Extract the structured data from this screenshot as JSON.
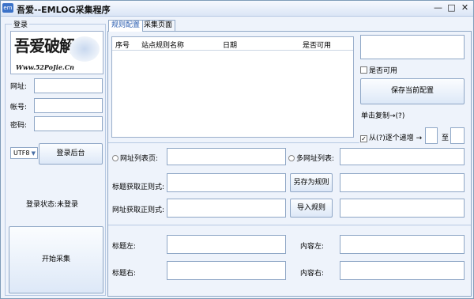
{
  "window": {
    "title": "吾爱--EMLOG采集程序",
    "icon_text": "em",
    "minimize": "—",
    "maximize": "□",
    "close": "✕"
  },
  "login": {
    "group_title": "登录",
    "logo_text": "吾爱破解",
    "logo_url": "Www.52PoJie.Cn",
    "url_label": "网址:",
    "url_value": "",
    "account_label": "帐号:",
    "account_value": "",
    "password_label": "密码:",
    "password_value": "",
    "encoding": "UTF8",
    "login_button": "登录后台",
    "status_label": "登录状态:",
    "status_value": "未登录",
    "start_button": "开始采集"
  },
  "tabs": [
    {
      "label": "规则配置"
    },
    {
      "label": "采集页面"
    }
  ],
  "rules_table": {
    "columns": [
      "序号",
      "站点规则名称",
      "日期",
      "是否可用"
    ],
    "rows": []
  },
  "right_panel": {
    "available_label": "是否可用",
    "save_button": "保存当前配置",
    "copy_hint": "单击复制→(?)",
    "increment_label": "从(?)逐个递增 →",
    "to_label": "至",
    "from_value": "",
    "to_value": ""
  },
  "middle": {
    "url_list_label": "网址列表页:",
    "multi_url_label": "多网址列表:",
    "title_regex_label": "标题获取正则式:",
    "url_regex_label": "网址获取正则式:",
    "save_as_button": "另存为规则",
    "import_button": "导入规则"
  },
  "bottom": {
    "title_left": "标题左:",
    "title_right": "标题右:",
    "content_left": "内容左:",
    "content_right": "内容右:"
  }
}
